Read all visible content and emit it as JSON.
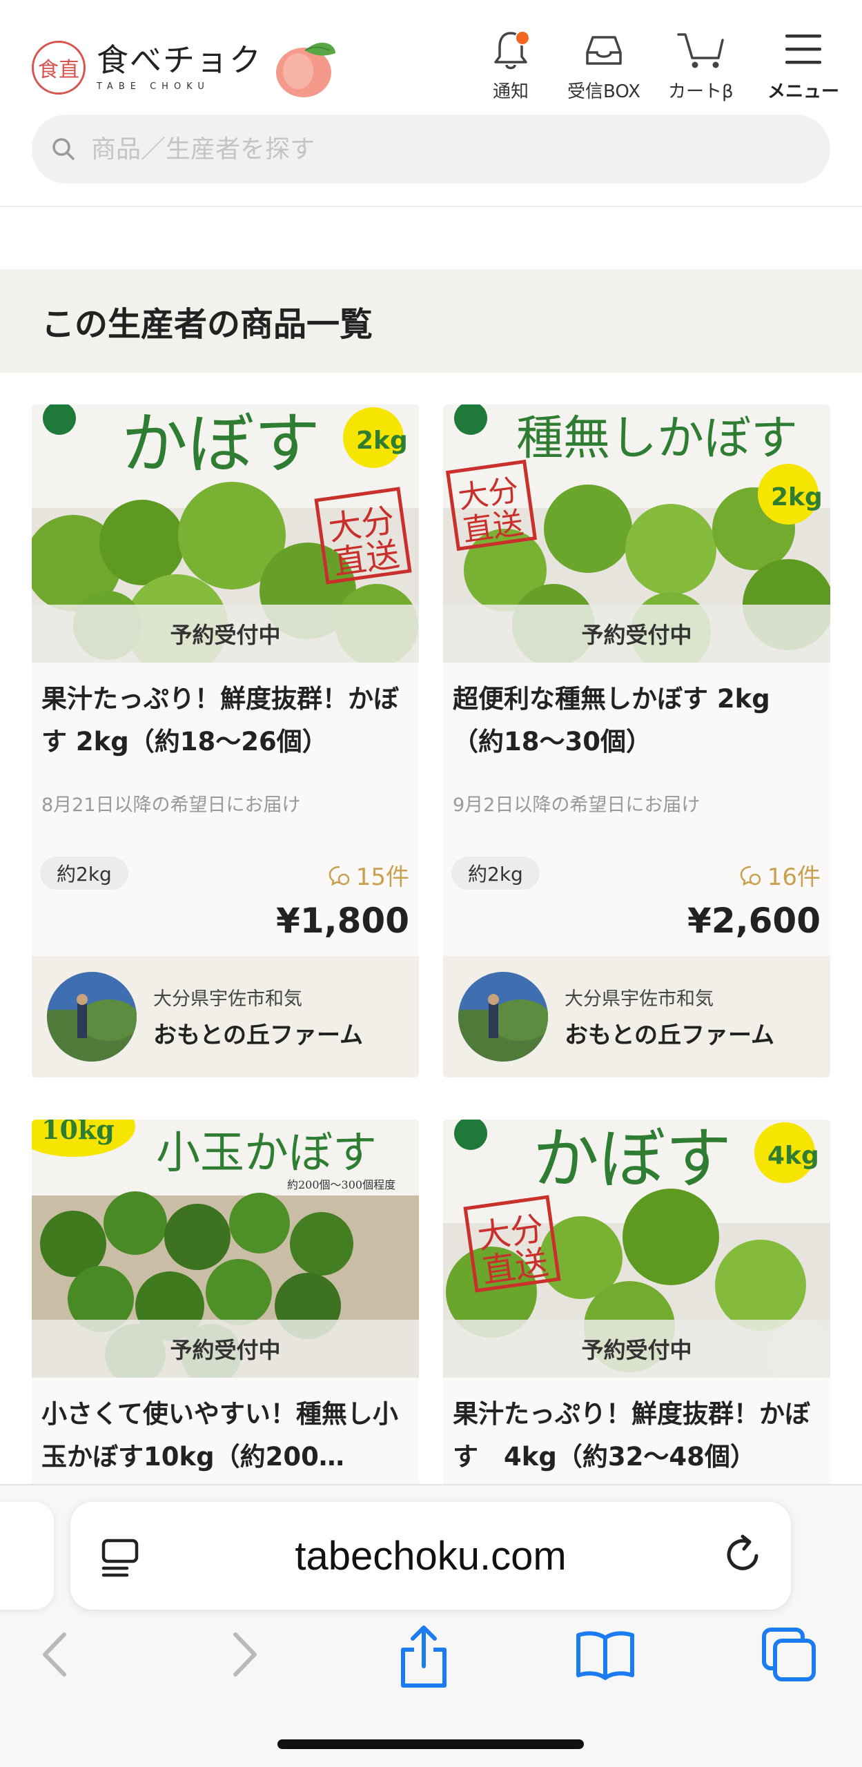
{
  "header": {
    "logo_seal": "食直",
    "logo_text": "食べチョク",
    "logo_sub": "TABE CHOKU",
    "nav": {
      "notify": "通知",
      "inbox": "受信BOX",
      "cart": "カートβ",
      "menu": "メニュー"
    },
    "search_placeholder": "商品／生産者を探す"
  },
  "section": {
    "title": "この生産者の商品一覧"
  },
  "products": [
    {
      "image_caption": "かぼす 2kg",
      "status": "予約受付中",
      "title": "果汁たっぷり！鮮度抜群！かぼす 2kg（約18〜26個）",
      "delivery": "8月21日以降の希望日にお届け",
      "weight": "約2kg",
      "reviews": "15件",
      "price": "¥1,800",
      "producer_location": "大分県宇佐市和気",
      "producer_name": "おもとの丘ファーム"
    },
    {
      "image_caption": "種無しかぼす 2kg",
      "status": "予約受付中",
      "title": "超便利な種無しかぼす 2kg（約18〜30個）",
      "delivery": "9月2日以降の希望日にお届け",
      "weight": "約2kg",
      "reviews": "16件",
      "price": "¥2,600",
      "producer_location": "大分県宇佐市和気",
      "producer_name": "おもとの丘ファーム"
    },
    {
      "image_caption": "小玉かぼす 10kg",
      "status": "予約受付中",
      "title": "小さくて使いやすい！種無し小玉かぼす10kg（約200…"
    },
    {
      "image_caption": "かぼす 4kg",
      "status": "予約受付中",
      "title": "果汁たっぷり！鮮度抜群！かぼす　4kg（約32〜48個）"
    }
  ],
  "browser": {
    "url": "tabechoku.com"
  },
  "colors": {
    "accent_orange": "#f26522",
    "review_gold": "#c8a050",
    "safari_blue": "#1a7cf0",
    "section_bg": "#f3f1ec"
  }
}
